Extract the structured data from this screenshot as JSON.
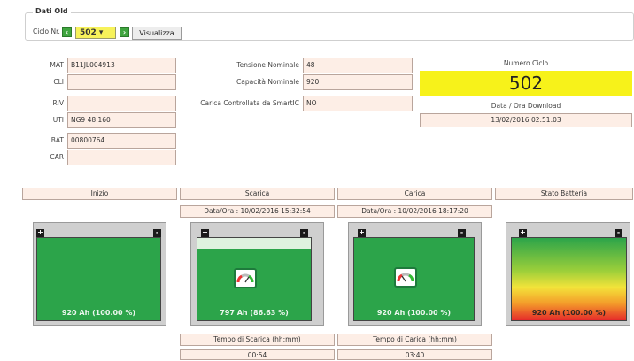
{
  "legend": "Dati Old",
  "ciclo_nr_label": "Ciclo Nr.",
  "ciclo_select": "502 ▾",
  "nav_prev": "‹",
  "nav_next": "›",
  "visualizza": "Visualizza",
  "fields_left": [
    {
      "label": "MAT",
      "value": "B11JL004913"
    },
    {
      "label": "CLI",
      "value": ""
    },
    {
      "label": "RIV",
      "value": ""
    },
    {
      "label": "UTI",
      "value": "NG9 48 160"
    },
    {
      "label": "BAT",
      "value": "00800764"
    },
    {
      "label": "CAR",
      "value": ""
    }
  ],
  "fields_mid": [
    {
      "label": "Tensione Nominale",
      "value": "48"
    },
    {
      "label": "Capacità Nominale",
      "value": "920"
    },
    {
      "label": "Carica Controllata da SmartIC",
      "value": "NO"
    }
  ],
  "numero_ciclo_label": "Numero Ciclo",
  "numero_ciclo_value": "502",
  "download_label": "Data / Ora Download",
  "download_value": "13/02/2016 02:51:03",
  "columns": {
    "inizio": "Inizio",
    "scarica": "Scarica",
    "carica": "Carica",
    "stato": "Stato Batteria"
  },
  "scarica_date": "Data/Ora : 10/02/2016 15:32:54",
  "carica_date": "Data/Ora : 10/02/2016 18:17:20",
  "batteries": {
    "inizio": {
      "text": "920 Ah (100.00 %)",
      "charge_fraction": 1.0
    },
    "scarica": {
      "text": "797 Ah (86.63 %)",
      "charge_fraction": 0.8663
    },
    "carica": {
      "text": "920 Ah (100.00 %)",
      "charge_fraction": 1.0
    },
    "stato": {
      "text": "920 Ah (100.00 %)",
      "charge_fraction": 1.0
    }
  },
  "terminal_plus": "+",
  "terminal_minus": "-",
  "tempo_scarica_label": "Tempo di Scarica (hh:mm)",
  "tempo_scarica_value": "00:54",
  "tempo_carica_label": "Tempo di Carica (hh:mm)",
  "tempo_carica_value": "03:40",
  "colors": {
    "battery_green": "#2ca44a",
    "field_bg": "#fdeee6",
    "ciclo_highlight": "#f7f21a"
  }
}
